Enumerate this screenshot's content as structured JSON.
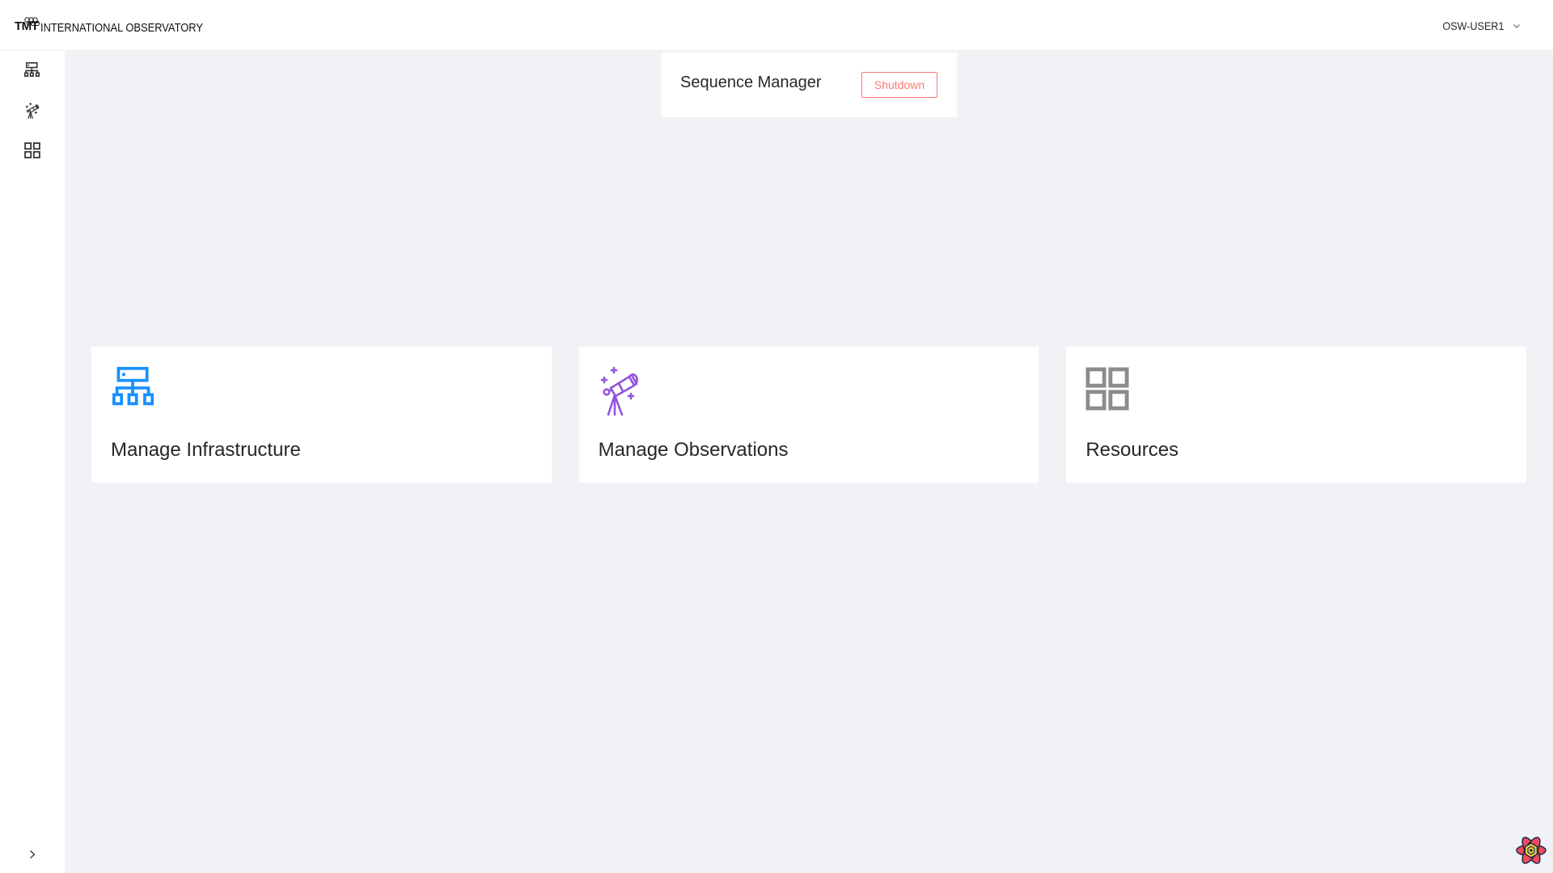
{
  "header": {
    "logo_short": "TMT",
    "logo_name": "INTERNATIONAL OBSERVATORY",
    "user": "OSW-USER1",
    "user_menu_icon": "chevron-down-icon"
  },
  "sidebar": {
    "items": [
      {
        "key": "infrastructure",
        "icon": "network-icon"
      },
      {
        "key": "observations",
        "icon": "telescope-icon"
      },
      {
        "key": "resources",
        "icon": "grid-icon"
      }
    ],
    "collapse_icon": "chevron-right-icon"
  },
  "sequence_manager": {
    "title": "Sequence Manager",
    "action_label": "Shutdown",
    "action_color": "#ff7875"
  },
  "cards": [
    {
      "title": "Manage Infrastructure",
      "icon": "network-icon",
      "color": "#1890ff"
    },
    {
      "title": "Manage Observations",
      "icon": "telescope-icon",
      "color": "#9254de"
    },
    {
      "title": "Resources",
      "icon": "grid-icon",
      "color": "#8c8c8c"
    }
  ],
  "devtools": {
    "icon": "react-query-devtools-icon"
  }
}
